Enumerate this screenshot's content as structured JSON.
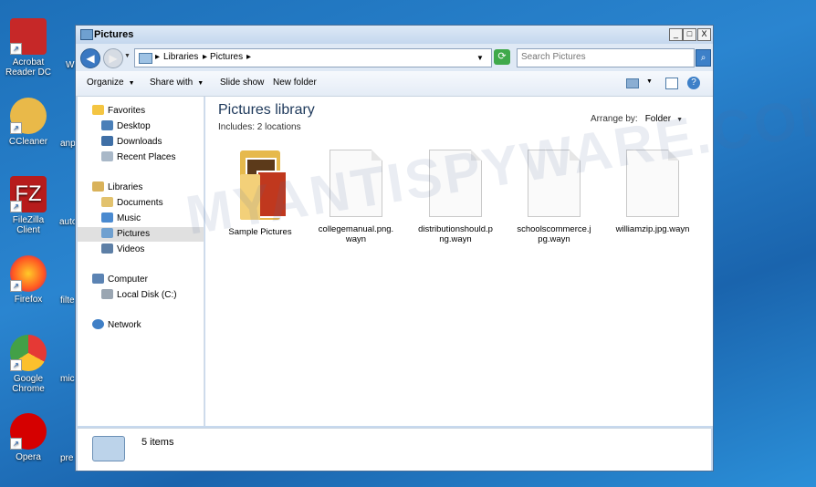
{
  "desktop": {
    "icons": [
      {
        "label": "Acrobat Reader DC",
        "color": "#c62828"
      },
      {
        "label": "CCleaner",
        "color": "#d32f2f"
      },
      {
        "label": "FileZilla Client",
        "color": "#b71c1c"
      },
      {
        "label": "Firefox",
        "color": "#ff7043"
      },
      {
        "label": "Google Chrome",
        "color": "#43a047"
      },
      {
        "label": "Opera",
        "color": "#d50000"
      }
    ],
    "cut_labels": [
      "W",
      "anp",
      "auto",
      "filte",
      "mic",
      "pre"
    ]
  },
  "window": {
    "title": "Pictures",
    "controls": {
      "minimize": "_",
      "maximize": "□",
      "close": "X"
    },
    "address": {
      "crumbs": [
        "Libraries",
        "Pictures"
      ]
    },
    "search": {
      "placeholder": "Search Pictures"
    },
    "toolbar": {
      "organize": "Organize",
      "share_with": "Share with",
      "slide_show": "Slide show",
      "new_folder": "New folder"
    },
    "nav": {
      "favorites": "Favorites",
      "favorites_items": [
        "Desktop",
        "Downloads",
        "Recent Places"
      ],
      "libraries": "Libraries",
      "libraries_items": [
        "Documents",
        "Music",
        "Pictures",
        "Videos"
      ],
      "computer": "Computer",
      "computer_items": [
        "Local Disk (C:)"
      ],
      "network": "Network"
    },
    "content": {
      "title": "Pictures library",
      "subtitle": "Includes:  2 locations",
      "arrange_label": "Arrange by:",
      "arrange_value": "Folder",
      "files": [
        {
          "name": "Sample Pictures",
          "type": "folder"
        },
        {
          "name": "collegemanual.png.\nwayn",
          "type": "file"
        },
        {
          "name": "distributionshould.p\nng.wayn",
          "type": "file"
        },
        {
          "name": "schoolscommerce.j\npg.wayn",
          "type": "file"
        },
        {
          "name": "williamzip.jpg.wayn",
          "type": "file"
        }
      ]
    },
    "status": {
      "count": "5 items"
    }
  },
  "watermark": "MYANTISPYWARE.COM",
  "colors": {
    "accent": "#1e395b",
    "desktop": "#2a85d0"
  }
}
